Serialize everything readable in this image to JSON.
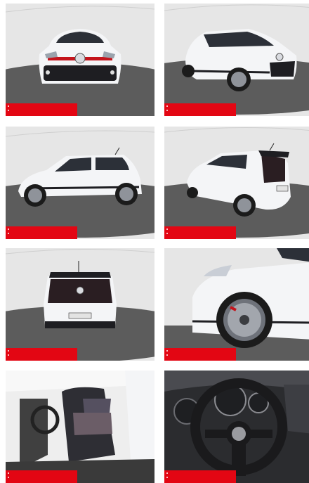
{
  "gallery": {
    "thumbnails": [
      {
        "view": "front"
      },
      {
        "view": "front-right-three-quarter"
      },
      {
        "view": "left-side"
      },
      {
        "view": "rear-left-three-quarter"
      },
      {
        "view": "rear"
      },
      {
        "view": "front-wheel-detail"
      },
      {
        "view": "interior-seats"
      },
      {
        "view": "steering-wheel-dashboard"
      }
    ]
  },
  "colors": {
    "accent": "#e30613",
    "car_body": "#f4f5f7",
    "floor": "#5b5b5b",
    "backdrop": "#e4e4e4"
  },
  "icons": [
    "image-label-banner",
    "dot-indicator"
  ]
}
